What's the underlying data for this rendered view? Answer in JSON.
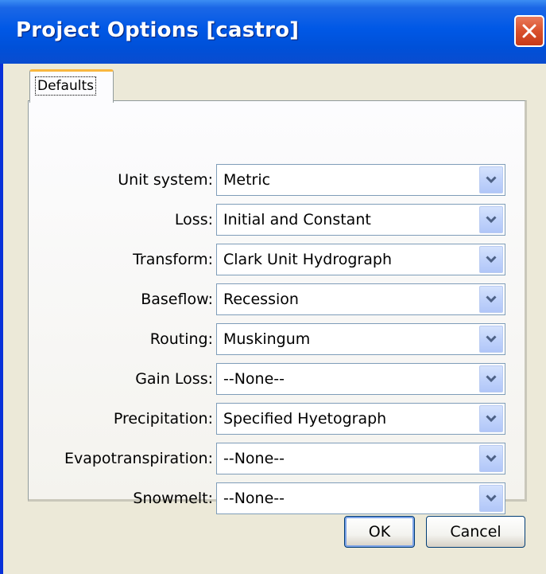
{
  "window": {
    "title": "Project Options [castro]",
    "close_label": "Close"
  },
  "tabs": [
    {
      "label": "Defaults",
      "selected": true
    }
  ],
  "fields": [
    {
      "label": "Unit system:",
      "value": "Metric"
    },
    {
      "label": "Loss:",
      "value": "Initial and Constant"
    },
    {
      "label": "Transform:",
      "value": "Clark Unit Hydrograph"
    },
    {
      "label": "Baseflow:",
      "value": "Recession"
    },
    {
      "label": "Routing:",
      "value": "Muskingum"
    },
    {
      "label": "Gain Loss:",
      "value": "--None--"
    },
    {
      "label": "Precipitation:",
      "value": "Specified Hyetograph"
    },
    {
      "label": "Evapotranspiration:",
      "value": "--None--"
    },
    {
      "label": "Snowmelt:",
      "value": "--None--"
    }
  ],
  "buttons": {
    "ok_label": "OK",
    "cancel_label": "Cancel"
  },
  "icons": {
    "close": "close-x-icon",
    "dropdown": "chevron-down-icon"
  },
  "colors": {
    "titlebar": "#0058e6",
    "close_button": "#d9502c",
    "dialog_background": "#ece9d8",
    "tab_highlight": "#f9b73f",
    "combo_border": "#7f9db9"
  }
}
